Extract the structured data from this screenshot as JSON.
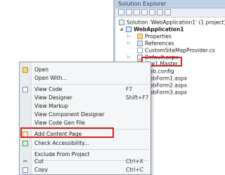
{
  "solution_explorer": {
    "title": "Solution Explorer",
    "items": [
      {
        "label": "Solution 'WebApplication1' (1 project)",
        "icon": "solution-icon"
      },
      {
        "label": "WebApplication1",
        "icon": "web-project-icon"
      },
      {
        "label": "Properties",
        "icon": "properties-folder-icon"
      },
      {
        "label": "References",
        "icon": "references-icon"
      },
      {
        "label": "CustomSiteMapProvider.cs",
        "icon": "cs-file-icon"
      },
      {
        "label": "Default.aspx",
        "icon": "aspx-file-icon"
      },
      {
        "label": "Site1.Master",
        "icon": "master-page-icon"
      },
      {
        "label": "Web.config",
        "icon": "config-file-icon"
      },
      {
        "label": "WebForm1.aspx",
        "icon": "aspx-file-icon"
      },
      {
        "label": "WebForm2.aspx",
        "icon": "aspx-file-icon"
      },
      {
        "label": "WebForm3.aspx",
        "icon": "aspx-file-icon"
      }
    ]
  },
  "context_menu": {
    "items": [
      {
        "label": "Open",
        "shortcut": "",
        "icon": "open-icon"
      },
      {
        "label": "Open With...",
        "shortcut": ""
      },
      {
        "label": "View Code",
        "shortcut": "F7",
        "icon": "view-code-icon"
      },
      {
        "label": "View Designer",
        "shortcut": "Shift+F7"
      },
      {
        "label": "View Markup",
        "shortcut": ""
      },
      {
        "label": "View Component Designer",
        "shortcut": ""
      },
      {
        "label": "View Code Gen File",
        "shortcut": ""
      },
      {
        "label": "Add Content Page",
        "shortcut": "",
        "icon": "add-content-page-icon"
      },
      {
        "label": "Check Accessibility...",
        "shortcut": "",
        "icon": "accessibility-icon"
      },
      {
        "label": "Exclude From Project",
        "shortcut": ""
      },
      {
        "label": "Cut",
        "shortcut": "Ctrl+X",
        "icon": "cut-icon"
      },
      {
        "label": "Copy",
        "shortcut": "Ctrl+C",
        "icon": "copy-icon"
      }
    ]
  },
  "colors": {
    "highlight_box": "#d42020",
    "panel_title_bg": "#c2d2e5"
  }
}
